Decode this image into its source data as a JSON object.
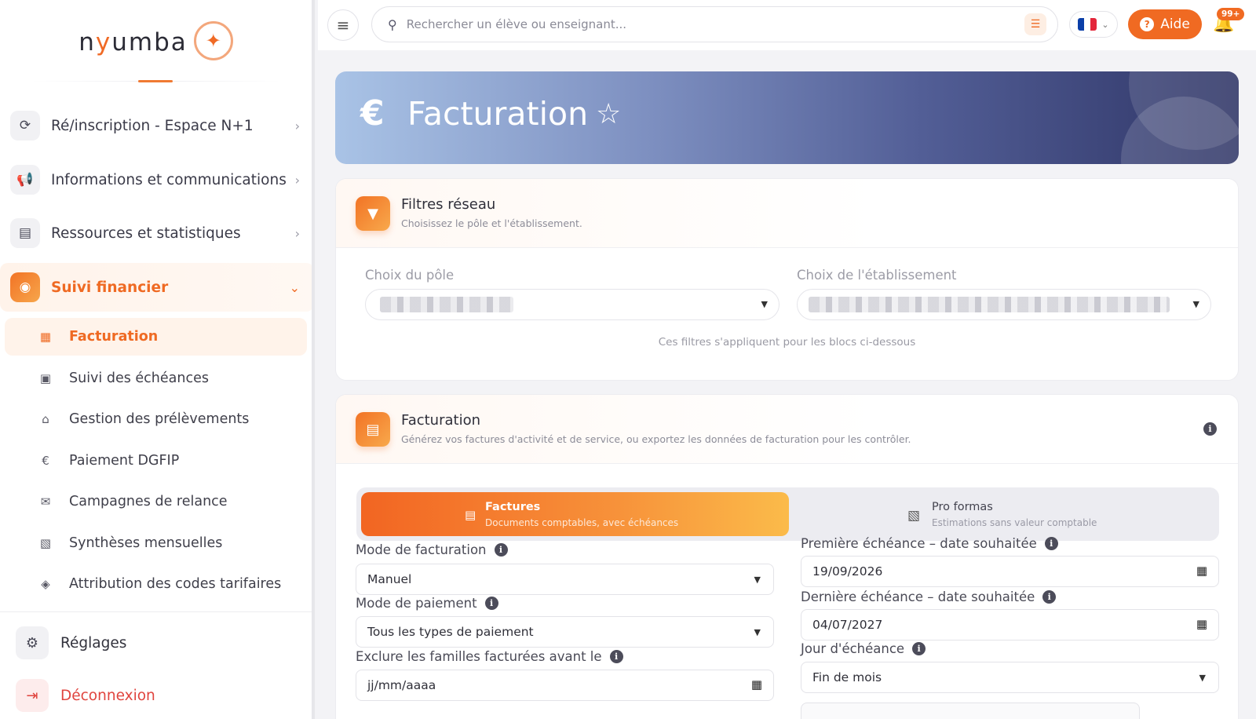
{
  "brand": {
    "name_pre": "n",
    "name_y": "y",
    "name_post": "umba"
  },
  "sidebar": {
    "items": [
      {
        "label": "Ré/inscription - Espace N+1",
        "icon": "refresh-icon"
      },
      {
        "label": "Informations et communications",
        "icon": "megaphone-icon"
      },
      {
        "label": "Ressources et statistiques",
        "icon": "archive-icon"
      },
      {
        "label": "Suivi financier",
        "icon": "coins-icon"
      }
    ],
    "subitems": [
      {
        "label": "Facturation",
        "icon": "invoice-icon"
      },
      {
        "label": "Suivi des échéances",
        "icon": "calendar-check-icon"
      },
      {
        "label": "Gestion des prélèvements",
        "icon": "bank-icon"
      },
      {
        "label": "Paiement DGFIP",
        "icon": "euro-icon"
      },
      {
        "label": "Campagnes de relance",
        "icon": "mail-open-icon"
      },
      {
        "label": "Synthèses mensuelles",
        "icon": "pdf-icon"
      },
      {
        "label": "Attribution des codes tarifaires",
        "icon": "tags-icon"
      }
    ],
    "footer": {
      "settings": "Réglages",
      "logout": "Déconnexion"
    }
  },
  "topbar": {
    "search_placeholder": "Rechercher un élève ou enseignant...",
    "help_label": "Aide",
    "notif_count": "99+",
    "flag_colors": [
      "#0b3fa8",
      "#ffffff",
      "#e3263a"
    ]
  },
  "hero": {
    "title": "Facturation",
    "symbol": "€"
  },
  "filters": {
    "title": "Filtres réseau",
    "subtitle": "Choisissez le pôle et l'établissement.",
    "pole_label": "Choix du pôle",
    "etab_label": "Choix de l'établissement",
    "note": "Ces filtres s'appliquent pour les blocs ci-dessous"
  },
  "billing": {
    "title": "Facturation",
    "subtitle": "Générez vos factures d'activité et de service, ou exportez les données de facturation pour les contrôler.",
    "tabs": [
      {
        "title": "Factures",
        "subtitle": "Documents comptables, avec échéances"
      },
      {
        "title": "Pro formas",
        "subtitle": "Estimations sans valeur comptable"
      }
    ],
    "fields": {
      "mode_facturation": {
        "label": "Mode de facturation",
        "value": "Manuel"
      },
      "mode_paiement": {
        "label": "Mode de paiement",
        "value": "Tous les types de paiement"
      },
      "exclure": {
        "label": "Exclure les familles facturées avant le",
        "value": "jj/mm/aaaa"
      },
      "premiere": {
        "label": "Première échéance – date souhaitée",
        "value": "19/09/2026"
      },
      "derniere": {
        "label": "Dernière échéance – date souhaitée",
        "value": "04/07/2027"
      },
      "jour": {
        "label": "Jour d'échéance",
        "value": "Fin de mois"
      }
    }
  },
  "colors": {
    "accent": "#f06a22",
    "hero_start": "#a9c3e6",
    "hero_end": "#2f3566"
  }
}
